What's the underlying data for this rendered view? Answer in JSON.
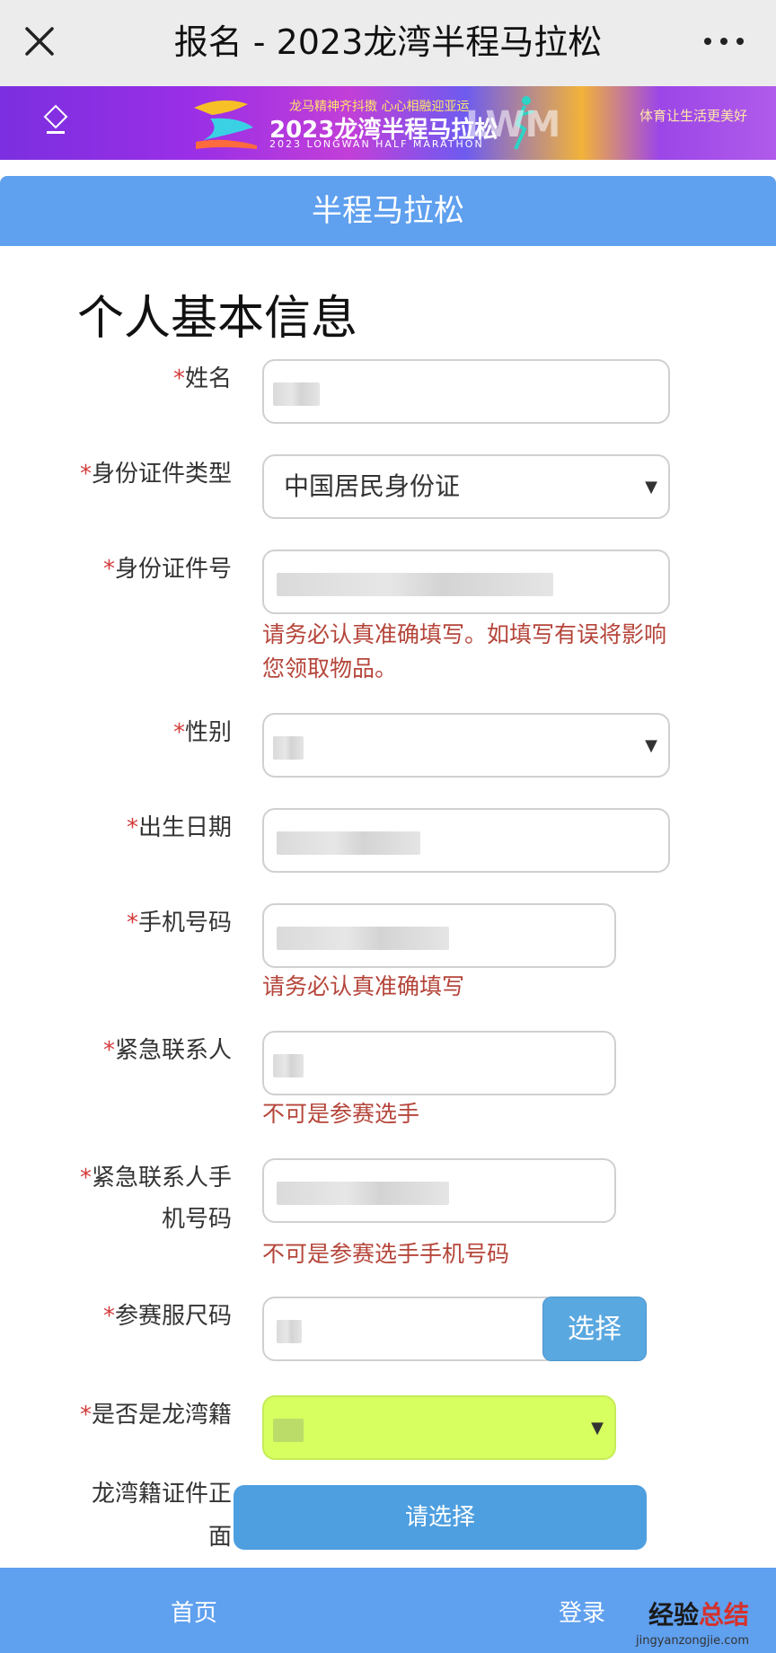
{
  "window": {
    "title": "报名 - 2023龙湾半程马拉松"
  },
  "banner": {
    "slogan": "龙马精神齐抖擞 心心相融迎亚运",
    "event_title": "2023龙湾半程马拉松",
    "event_title_en": "2023 LONGWAN HALF MARATHON",
    "mark": "LWM",
    "motto": "体育让生活更美好"
  },
  "section": {
    "title": "半程马拉松"
  },
  "form": {
    "heading": "个人基本信息",
    "required_mark": "*",
    "name_label": "姓名",
    "id_type_label": "身份证件类型",
    "id_type_value": "中国居民身份证",
    "id_number_label": "身份证件号",
    "id_number_hint": "请务必认真准确填写。如填写有误将影响您领取物品。",
    "gender_label": "性别",
    "birthdate_label": "出生日期",
    "phone_label": "手机号码",
    "phone_hint": "请务必认真准确填写",
    "emergency_contact_label": "紧急联系人",
    "emergency_contact_hint": "不可是参赛选手",
    "emergency_phone_label_1": "紧急联系人手",
    "emergency_phone_label_2": "机号码",
    "emergency_phone_hint": "不可是参赛选手手机号码",
    "shirt_size_label": "参赛服尺码",
    "shirt_size_button": "选择",
    "longwan_label": "是否是龙湾籍",
    "upload_label_1": "龙湾籍证件正",
    "upload_label_2": "面",
    "upload_button": "请选择",
    "caret": "▼"
  },
  "bottom_nav": {
    "home": "首页",
    "login": "登录"
  },
  "watermark": {
    "part1": "经验",
    "part2": "总结",
    "url": "jingyanzongjie.com"
  },
  "colors": {
    "accent_blue": "#5fa0ef",
    "hint_red": "#b5453a",
    "highlight_green": "#d6ff5f"
  }
}
